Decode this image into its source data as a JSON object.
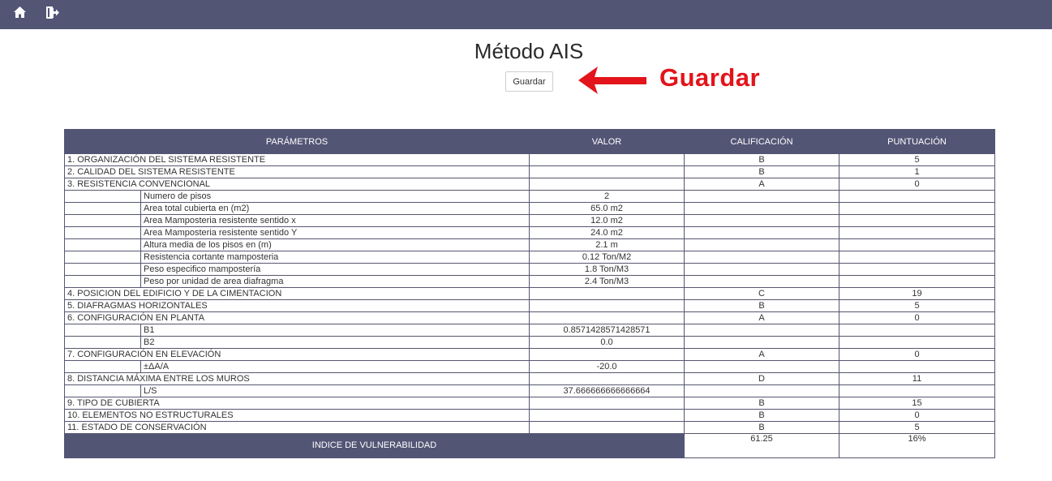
{
  "nav": {
    "home_icon": "home-icon",
    "exit_icon": "logout-icon"
  },
  "page": {
    "title": "Método AIS",
    "save_label": "Guardar",
    "annotation_label": "Guardar",
    "annotation_color": "#e3141b",
    "header_color": "#535575"
  },
  "table": {
    "headers": [
      "PARÁMETROS",
      "VALOR",
      "CALIFICACIÓN",
      "PUNTUACIÓN"
    ],
    "rows": [
      {
        "label": "1. ORGANIZACIÓN DEL SISTEMA RESISTENTE",
        "value": "",
        "grade": "B",
        "score": "5"
      },
      {
        "label": "2. CALIDAD DEL SISTEMA RESISTENTE",
        "value": "",
        "grade": "B",
        "score": "1"
      },
      {
        "label": "3. RESISTENCIA CONVENCIONAL",
        "value": "",
        "grade": "A",
        "score": "0"
      },
      {
        "sub": "Numero de pisos",
        "value": "2"
      },
      {
        "sub": "Area total cubierta en (m2)",
        "value": "65.0 m2"
      },
      {
        "sub": "Area Mamposteria resistente sentido x",
        "value": "12.0 m2"
      },
      {
        "sub": "Area Mamposteria resistente sentido Y",
        "value": "24.0 m2"
      },
      {
        "sub": "Altura media de los pisos en (m)",
        "value": "2.1 m"
      },
      {
        "sub": "Resistencia cortante mamposteria",
        "value": "0.12 Ton/M2"
      },
      {
        "sub": "Peso especifico mampostería",
        "value": "1.8 Ton/M3"
      },
      {
        "sub": "Peso por unidad de area diafragma",
        "value": "2.4 Ton/M3"
      },
      {
        "label": "4. POSICION DEL EDIFICIO Y DE LA CIMENTACION",
        "value": "",
        "grade": "C",
        "score": "19"
      },
      {
        "label": "5. DIAFRAGMAS HORIZONTALES",
        "value": "",
        "grade": "B",
        "score": "5"
      },
      {
        "label": "6. CONFIGURACIÓN EN PLANTA",
        "value": "",
        "grade": "A",
        "score": "0"
      },
      {
        "sub": "B1",
        "value": "0.8571428571428571"
      },
      {
        "sub": "B2",
        "value": "0.0"
      },
      {
        "label": "7. CONFIGURACIÓN EN ELEVACIÓN",
        "value": "",
        "grade": "A",
        "score": "0"
      },
      {
        "sub": "±ΔA/A",
        "value": "-20.0"
      },
      {
        "label": "8. DISTANCIA MÁXIMA ENTRE LOS MUROS",
        "value": "",
        "grade": "D",
        "score": "11"
      },
      {
        "sub": "L/S",
        "value": "37.666666666666664"
      },
      {
        "label": "9. TIPO DE CUBIERTA",
        "value": "",
        "grade": "B",
        "score": "15"
      },
      {
        "label": "10. ELEMENTOS NO ESTRUCTURALES",
        "value": "",
        "grade": "B",
        "score": "0"
      },
      {
        "label": "11. ESTADO DE CONSERVACIÓN",
        "value": "",
        "grade": "B",
        "score": "5"
      }
    ],
    "footer": {
      "label": "INDICE DE VULNERABILIDAD",
      "index_value": "61.25",
      "percent": "16%"
    }
  }
}
